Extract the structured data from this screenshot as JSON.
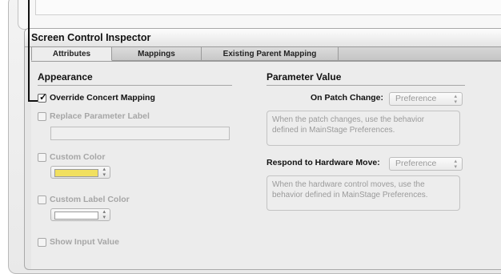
{
  "panel": {
    "title": "Screen Control Inspector"
  },
  "tabs": [
    {
      "label": "Attributes",
      "active": true
    },
    {
      "label": "Mappings",
      "active": false
    },
    {
      "label": "Existing Parent Mapping",
      "active": false
    },
    {
      "label": "",
      "active": false
    }
  ],
  "appearance": {
    "heading": "Appearance",
    "override_label": "Override Concert Mapping",
    "override_checked": true,
    "replace_label": "Replace Parameter Label",
    "replace_value": "",
    "custom_color_label": "Custom Color",
    "custom_color_swatch": "#f1e060",
    "custom_label_color_label": "Custom Label Color",
    "custom_label_color_swatch": "#ffffff",
    "show_input_label": "Show Input Value"
  },
  "parameter": {
    "heading": "Parameter Value",
    "patch_change_label": "On Patch Change:",
    "patch_change_value": "Preference",
    "patch_change_desc_line1": "When the patch changes, use the behavior",
    "patch_change_desc_line2": "defined in MainStage Preferences.",
    "hardware_move_label": "Respond to Hardware Move:",
    "hardware_move_value": "Preference",
    "hardware_move_desc_line1": "When the hardware control moves, use the",
    "hardware_move_desc_line2": "behavior defined in MainStage Preferences."
  }
}
